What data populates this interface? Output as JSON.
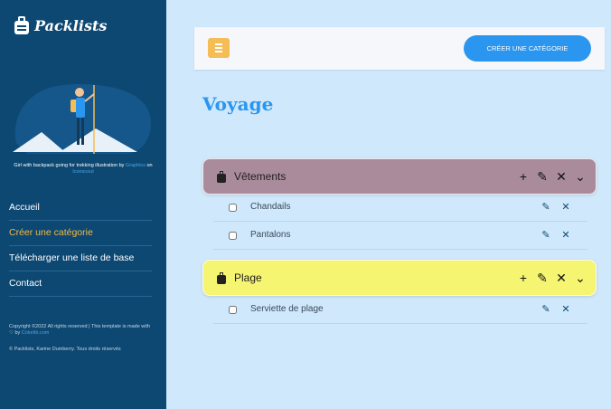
{
  "sidebar": {
    "brand_name": "Packlists",
    "credit_text": "Girl with backpack going for trekking illustration",
    "credit_by": "by",
    "credit_author": "Graphics",
    "credit_on": "on",
    "credit_site": "Iconscout",
    "nav": [
      {
        "label": "Accueil",
        "active": false
      },
      {
        "label": "Créer une catégorie",
        "active": true
      },
      {
        "label": "Télécharger une liste de base",
        "active": false
      },
      {
        "label": "Contact",
        "active": false
      }
    ],
    "copyright_line": "Copyright ©2022 All rights reserved | This template is made with ♡ by",
    "copyright_link": "Colorlib.com",
    "copyright_footer": "© Packlists, Karine Dumberry. Tous droits réservés"
  },
  "topbar": {
    "create_label": "CRÉER UNE CATÉGORIE"
  },
  "page_title": "Voyage",
  "categories": [
    {
      "name": "Vêtements",
      "color": "#a98b9b",
      "items": [
        {
          "name": "Chandails",
          "checked": false
        },
        {
          "name": "Pantalons",
          "checked": false
        }
      ]
    },
    {
      "name": "Plage",
      "color": "#f6f571",
      "items": [
        {
          "name": "Serviette de plage",
          "checked": false
        }
      ]
    }
  ],
  "icons": {
    "add": "+",
    "edit": "✎",
    "delete": "✕",
    "expand": "⌄"
  },
  "colors": {
    "sidebar_bg": "#0d4873",
    "page_bg": "#cfe8fc",
    "accent_blue": "#2a96f0",
    "accent_orange": "#f5b942"
  }
}
